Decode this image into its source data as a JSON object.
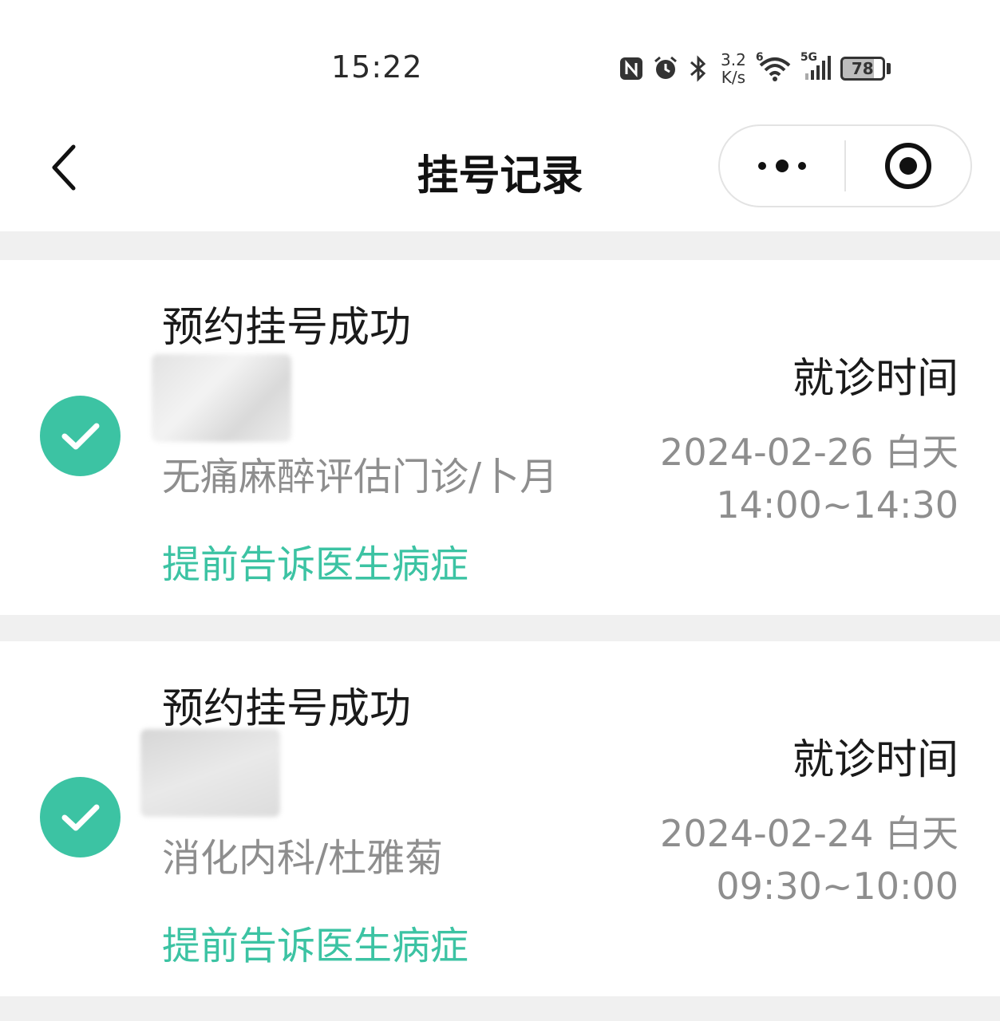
{
  "status_bar": {
    "time": "15:22",
    "net_speed_value": "3.2",
    "net_speed_unit": "K/s",
    "wifi_badge": "6",
    "cell_badge": "5G",
    "battery_level": "78",
    "icons": [
      "nfc-icon",
      "alarm-icon",
      "bluetooth-icon",
      "wifi-icon",
      "signal-icon",
      "battery-icon"
    ]
  },
  "nav": {
    "title": "挂号记录",
    "back_icon": "chevron-left-icon",
    "more_icon": "more-dots-icon",
    "close_icon": "target-close-icon"
  },
  "accent_color": "#3cc3a3",
  "records": [
    {
      "status": "预约挂号成功",
      "department_doctor": "无痛麻醉评估门诊/卜月",
      "action_link": "提前告诉医生病症",
      "visit_label": "就诊时间",
      "visit_date": "2024-02-26 白天",
      "visit_range": "14:00~14:30"
    },
    {
      "status": "预约挂号成功",
      "department_doctor": "消化内科/杜雅菊",
      "action_link": "提前告诉医生病症",
      "visit_label": "就诊时间",
      "visit_date": "2024-02-24 白天",
      "visit_range": "09:30~10:00"
    }
  ]
}
